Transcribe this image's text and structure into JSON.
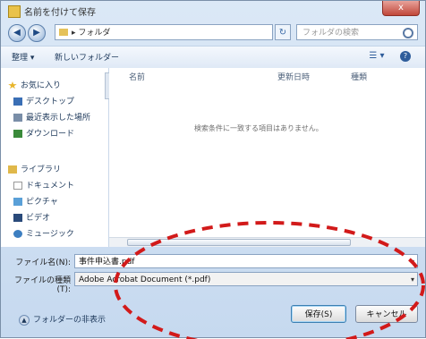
{
  "window": {
    "title": "名前を付けて保存",
    "close_label": "x"
  },
  "address_bar": {
    "back_glyph": "◀",
    "forward_glyph": "▶",
    "path": "▸ フォルダ",
    "refresh_glyph": "↻",
    "search_placeholder": "フォルダの検索"
  },
  "toolbar": {
    "organize_label": "整理 ▾",
    "new_folder_label": "新しいフォルダー",
    "view_glyph": "☰ ▾",
    "help_glyph": "?"
  },
  "nav_pane": {
    "favorites": [
      {
        "label": "お気に入り",
        "icon": "star-icon",
        "color": "#e8b52a"
      },
      {
        "label": "デスクトップ",
        "icon": "desktop-icon",
        "color": "#3a6fb5"
      },
      {
        "label": "最近表示した場所",
        "icon": "recent-places-icon",
        "color": "#7a8ea8"
      },
      {
        "label": "ダウンロード",
        "icon": "download-icon",
        "color": "#3a8a3a"
      }
    ],
    "libraries": [
      {
        "label": "ライブラリ",
        "icon": "library-icon",
        "color": "#e0b84a"
      },
      {
        "label": "ドキュメント",
        "icon": "documents-icon",
        "color": "#d6d6d6"
      },
      {
        "label": "ピクチャ",
        "icon": "pictures-icon",
        "color": "#5aa0d8"
      },
      {
        "label": "ビデオ",
        "icon": "video-icon",
        "color": "#2a4a7a"
      },
      {
        "label": "ミュージック",
        "icon": "music-icon",
        "color": "#3d7fc1"
      }
    ]
  },
  "file_list": {
    "columns": [
      "名前",
      "更新日時",
      "種類"
    ],
    "empty_message": "検索条件に一致する項目はありません。"
  },
  "form": {
    "filename_label": "ファイル名(N):",
    "filename_value": "事件申込書.pdf",
    "filetype_label": "ファイルの種類(T):",
    "filetype_value": "Adobe Acrobat Document (*.pdf)"
  },
  "footer": {
    "hide_folders_label": "フォルダーの非表示",
    "save_label": "保存(S)",
    "cancel_label": "キャンセル"
  },
  "annotation": {
    "color": "#d21a1a"
  }
}
